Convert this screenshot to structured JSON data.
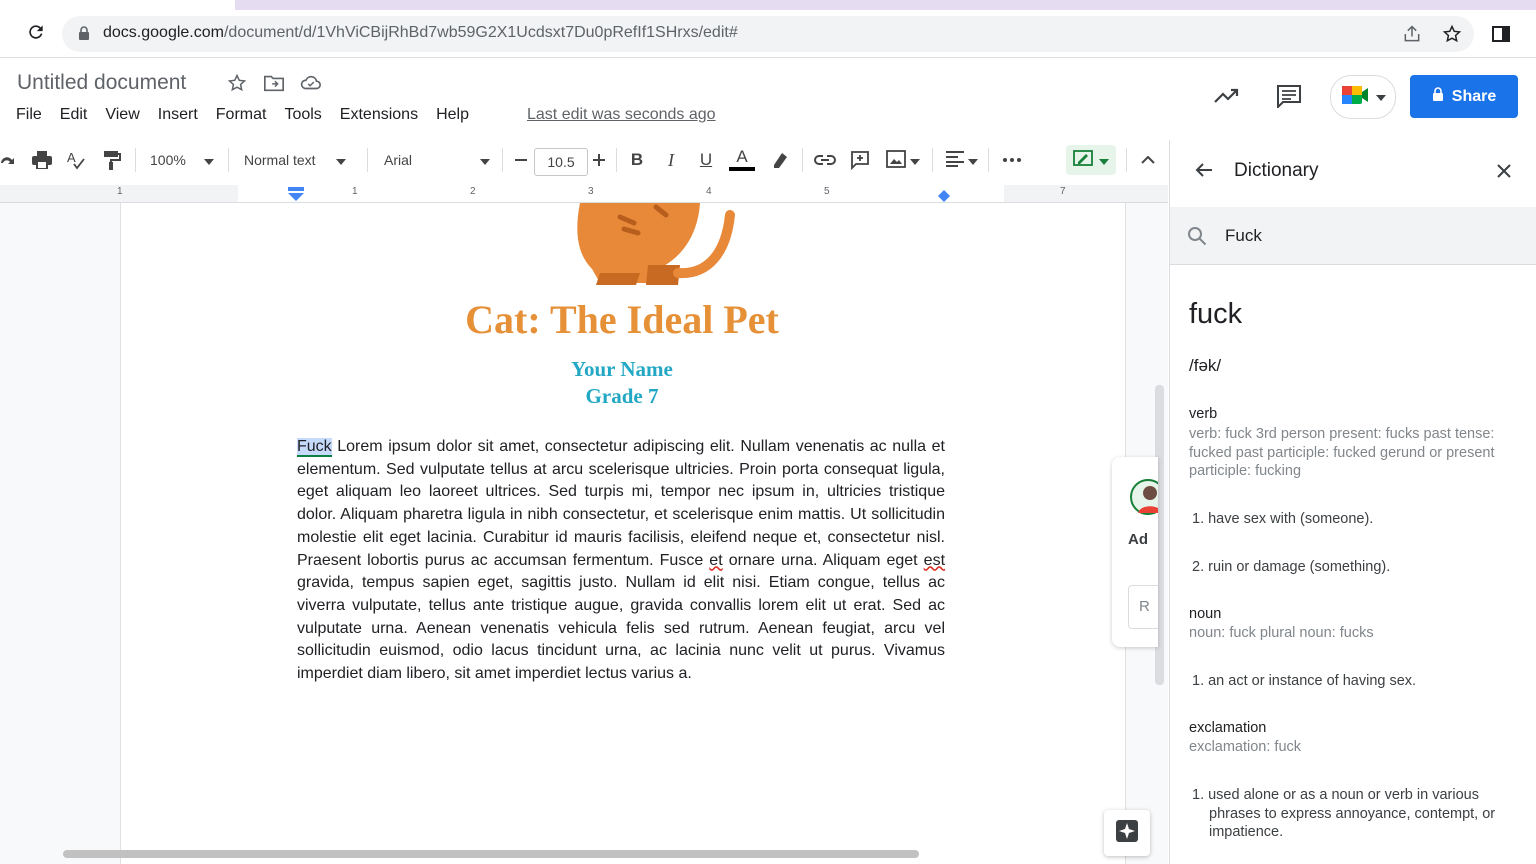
{
  "browser": {
    "url_host": "docs.google.com",
    "url_path": "/document/d/1VhViCBijRhBd7wb59G2X1Ucdsxt7Du0pRefIf1SHrxs/edit#"
  },
  "docs_header": {
    "title": "Untitled document",
    "menu": [
      "File",
      "Edit",
      "View",
      "Insert",
      "Format",
      "Tools",
      "Extensions",
      "Help"
    ],
    "last_edit": "Last edit was seconds ago",
    "share_label": "Share"
  },
  "toolbar": {
    "zoom": "100%",
    "style": "Normal text",
    "font": "Arial",
    "font_size": "10.5",
    "bold": "B",
    "italic": "I",
    "underline": "U",
    "text_color": "A"
  },
  "ruler": {
    "numbers": [
      "1",
      "1",
      "2",
      "3",
      "4",
      "5",
      "7"
    ]
  },
  "document": {
    "title": "Cat: The Ideal Pet",
    "name": "Your Name",
    "grade": "Grade 7",
    "selected_word": "Fuck",
    "body_1": " Lorem ipsum dolor sit amet, consectetur adipiscing elit. Nullam venenatis ac nulla et elementum. Sed vulputate tellus at arcu scelerisque ultricies. Proin porta consequat ligula, eget aliquam leo laoreet ultrices. Sed turpis mi, tempor nec ipsum in, ultricies tristique dolor. Aliquam pharetra ligula in nibh consectetur, et scelerisque enim mattis. Ut sollicitudin molestie elit eget lacinia. Curabitur id mauris facilisis, eleifend neque et, consectetur nisl. Praesent lobortis purus ac accumsan fermentum. Fusce ",
    "body_et": "et",
    "body_2": " ornare urna. Aliquam eget ",
    "body_est": "est",
    "body_3": " gravida, tempus sapien eget, sagittis justo. Nullam id elit nisi. Etiam congue, tellus ac viverra vulputate, tellus ante tristique augue, gravida convallis lorem elit ut erat. Sed ac vulputate urna. Aenean venenatis vehicula felis sed rutrum. Aenean feugiat, arcu vel sollicitudin euismod, odio lacus tincidunt urna, ac lacinia nunc velit ut purus. Vivamus imperdiet diam libero, sit amet imperdiet lectus varius a.",
    "side_card_text": "Ad",
    "side_card_input": "R"
  },
  "dictionary": {
    "panel_title": "Dictionary",
    "search_value": "Fuck",
    "word": "fuck",
    "phonetic": "/fək/",
    "verb_pos": "verb",
    "verb_forms": "verb: fuck 3rd person present: fucks past tense: fucked past participle: fucked gerund or present participle: fucking",
    "verb_def_1": "1. have sex with (someone).",
    "verb_def_2": "2. ruin or damage (something).",
    "noun_pos": "noun",
    "noun_forms": "noun: fuck plural noun: fucks",
    "noun_def_1": "1. an act or instance of having sex.",
    "excl_pos": "exclamation",
    "excl_forms": "exclamation: fuck",
    "excl_def_1": "1. used alone or as a noun or verb in various phrases to express annoyance, contempt, or impatience."
  },
  "colors": {
    "title_orange": "#e69138",
    "name_teal": "#22a8c4",
    "share_blue": "#1a73e8"
  }
}
